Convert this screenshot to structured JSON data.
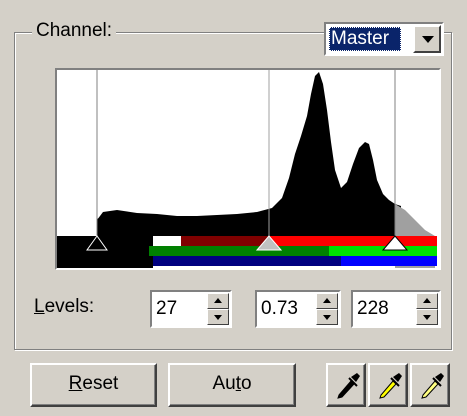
{
  "channel": {
    "label": "Channel:",
    "selected": "Master"
  },
  "histogram": {
    "colors": {
      "background": "#ffffff",
      "fill": "#000000",
      "dim": "#a0a0a0",
      "red": "#ff0000",
      "green": "#00c000",
      "blue": "#0000ff"
    }
  },
  "levels": {
    "label_prefix": "L",
    "label_rest": "evels:",
    "black": "27",
    "gamma": "0.73",
    "white": "228"
  },
  "buttons": {
    "reset_prefix": "R",
    "reset_rest": "eset",
    "auto_prefix": "Au",
    "auto_u": "t",
    "auto_rest": "o"
  },
  "eyedroppers": [
    "black-eyedropper-icon",
    "gray-eyedropper-icon",
    "white-eyedropper-icon"
  ]
}
